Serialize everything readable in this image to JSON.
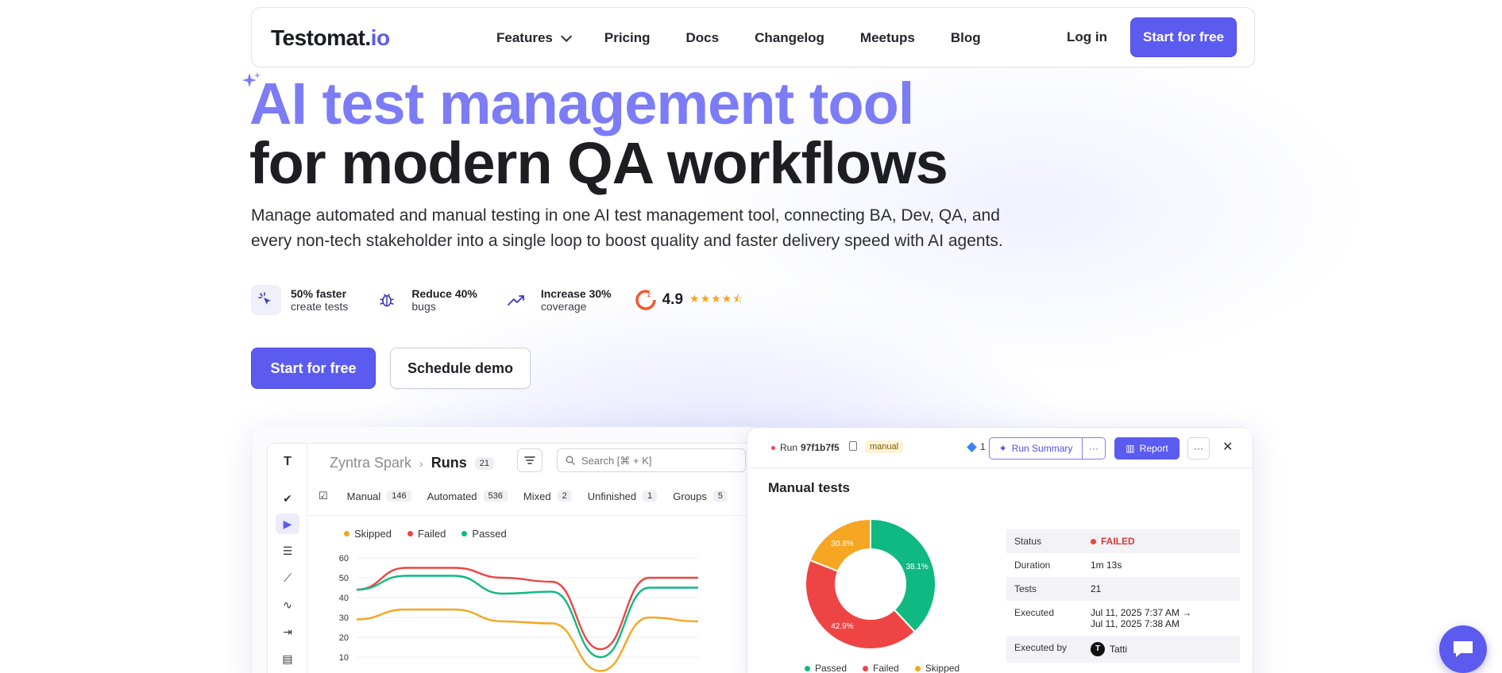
{
  "colors": {
    "brand": "#5b5bf0",
    "headline_accent": "#7c7cf6",
    "passed": "#10b981",
    "failed": "#ef4444",
    "skipped": "#f5a623"
  },
  "nav": {
    "logo_main": "Testomat.",
    "logo_io": "io",
    "links": [
      "Features",
      "Pricing",
      "Docs",
      "Changelog",
      "Meetups",
      "Blog"
    ],
    "login": "Log in",
    "cta": "Start for free"
  },
  "hero": {
    "title_line1": "AI test management tool",
    "title_line2": "for modern QA workflows",
    "subtitle_line1": "Manage automated and manual testing in one AI test management tool, connecting BA, Dev, QA, and",
    "subtitle_line2": "every non-tech stakeholder into a single loop to boost quality and faster delivery speed with AI agents.",
    "stats": [
      {
        "strong": "50% faster",
        "light": "create tests",
        "icon": "cursor-sparkle-icon"
      },
      {
        "strong": "Reduce 40%",
        "light": "bugs",
        "icon": "bug-icon"
      },
      {
        "strong": "Increase 30%",
        "light": "coverage",
        "icon": "trend-up-icon"
      }
    ],
    "rating": {
      "value": "4.9",
      "stars": 4.5,
      "icon": "g2-logo-icon"
    },
    "cta_primary": "Start for free",
    "cta_secondary": "Schedule demo"
  },
  "app": {
    "project": "Zyntra Spark",
    "section": "Runs",
    "section_count": "21",
    "search_placeholder": "Search [⌘ + K]",
    "tabs": [
      {
        "label": "Manual",
        "count": "146"
      },
      {
        "label": "Automated",
        "count": "536"
      },
      {
        "label": "Mixed",
        "count": "2"
      },
      {
        "label": "Unfinished",
        "count": "1"
      },
      {
        "label": "Groups",
        "count": "5"
      }
    ],
    "legend": [
      "Skipped",
      "Failed",
      "Passed"
    ]
  },
  "chart_data": [
    {
      "type": "line",
      "title": "",
      "xlabel": "",
      "ylabel": "",
      "ylim": [
        0,
        60
      ],
      "yticks": [
        0,
        10,
        20,
        30,
        40,
        50,
        60
      ],
      "grid": true,
      "legend": "top-left",
      "x": [
        0,
        1,
        2,
        3,
        4,
        5,
        6,
        7
      ],
      "series": [
        {
          "name": "Skipped",
          "values": [
            29,
            34,
            34,
            28,
            27,
            3,
            30,
            28
          ]
        },
        {
          "name": "Failed",
          "values": [
            44,
            55,
            55,
            50,
            48,
            14,
            50,
            50
          ]
        },
        {
          "name": "Passed",
          "values": [
            44,
            51,
            51,
            42,
            43,
            10,
            45,
            45
          ]
        }
      ]
    },
    {
      "type": "pie",
      "title": "Manual tests",
      "categories": [
        "Passed",
        "Failed",
        "Skipped"
      ],
      "values": [
        38.1,
        42.9,
        19.0
      ],
      "labels": [
        "38.1%",
        "42.9%",
        "30.8%"
      ],
      "legend": "bottom"
    }
  ],
  "run": {
    "run_label": "Run",
    "run_id": "97f1b7f5",
    "tag": "manual",
    "count": "1",
    "summary_btn": "Run Summary",
    "more_btn": "···",
    "report_btn": "Report",
    "close": "✕",
    "panel_title": "Manual tests",
    "legend": [
      "Passed",
      "Failed",
      "Skipped"
    ],
    "details": {
      "status_key": "Status",
      "status_val": "FAILED",
      "duration_key": "Duration",
      "duration_val": "1m 13s",
      "tests_key": "Tests",
      "tests_val": "21",
      "executed_key": "Executed",
      "executed_val1": "Jul 11, 2025 7:37 AM →",
      "executed_val2": "Jul 11, 2025 7:38 AM",
      "by_key": "Executed by",
      "by_val": "Tatti",
      "by_initial": "T"
    }
  }
}
